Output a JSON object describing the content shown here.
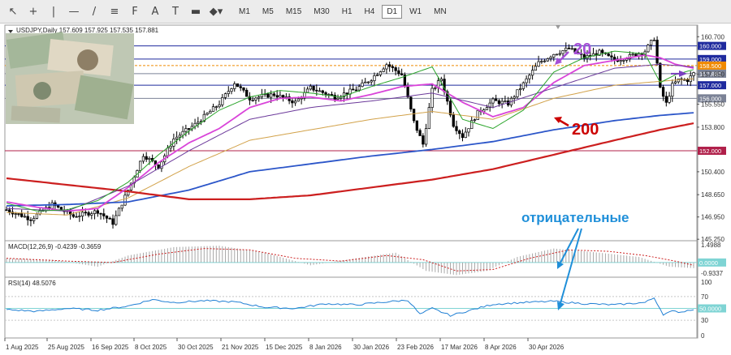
{
  "toolbar": {
    "tools": [
      {
        "name": "cursor-icon",
        "glyph": "↖"
      },
      {
        "name": "crosshair-icon",
        "glyph": "+"
      },
      {
        "name": "vertical-line-icon",
        "glyph": "|"
      },
      {
        "name": "horizontal-line-icon",
        "glyph": "—"
      },
      {
        "name": "trendline-icon",
        "glyph": "/"
      },
      {
        "name": "channel-icon",
        "glyph": "≡"
      },
      {
        "name": "fibonacci-icon",
        "glyph": "F"
      },
      {
        "name": "text-icon",
        "glyph": "A"
      },
      {
        "name": "text-label-icon",
        "glyph": "T"
      },
      {
        "name": "rectangle-icon",
        "glyph": "▬"
      },
      {
        "name": "shapes-dropdown-icon",
        "glyph": "◆▾"
      }
    ],
    "timeframes": [
      "M1",
      "M5",
      "M15",
      "M30",
      "H1",
      "H4",
      "D1",
      "W1",
      "MN"
    ],
    "active_timeframe": "D1"
  },
  "chart_data": {
    "type": "candlestick",
    "header": "USDJPY,Daily  157.609 157.925 157.535 157.881",
    "x_ticks": [
      "1 Aug 2025",
      "25 Aug 2025",
      "16 Sep 2025",
      "8 Oct 2025",
      "30 Oct 2025",
      "21 Nov 2025",
      "15 Dec 2025",
      "8 Jan 2026",
      "30 Jan 2026",
      "23 Feb 2026",
      "17 Mar 2026",
      "8 Apr 2026",
      "30 Apr 2026"
    ],
    "ylim": [
      145.2,
      161.4
    ],
    "y_ticks": [
      160.7,
      157.85,
      155.55,
      153.8,
      150.4,
      148.65,
      146.95,
      145.25
    ],
    "price_levels": [
      {
        "value": 160.0,
        "label": "160.000",
        "color": "#1f2a9e"
      },
      {
        "value": 159.0,
        "label": "159.000",
        "color": "#1f2a9e"
      },
      {
        "value": 158.5,
        "label": "158.500",
        "color": "#f08a00"
      },
      {
        "value": 157.881,
        "label": "157.881",
        "color": "#7b8296"
      },
      {
        "value": 157.0,
        "label": "157.000",
        "color": "#1f2a9e"
      },
      {
        "value": 156.0,
        "label": "156.000",
        "color": "#7b8296"
      },
      {
        "value": 152.0,
        "label": "152.000",
        "color": "#b0204a"
      }
    ],
    "bid_price": 157.881,
    "ma_labels": [
      {
        "text": "20",
        "color": "#a64fd6"
      },
      {
        "text": "200",
        "color": "#cc0000"
      }
    ],
    "annotation": {
      "text": "отрицательные",
      "color": "#1f8fd9"
    },
    "ma_anchors": {
      "ma20": [
        [
          0,
          148.1
        ],
        [
          10,
          147.7
        ],
        [
          20,
          147.4
        ],
        [
          30,
          147.6
        ],
        [
          40,
          149.2
        ],
        [
          50,
          151.1
        ],
        [
          60,
          152.6
        ],
        [
          70,
          153.7
        ],
        [
          80,
          155.3
        ],
        [
          90,
          156.0
        ],
        [
          100,
          156.1
        ],
        [
          110,
          155.8
        ],
        [
          120,
          156.3
        ],
        [
          130,
          156.9
        ],
        [
          140,
          157.1
        ],
        [
          150,
          155.7
        ],
        [
          160,
          154.6
        ],
        [
          170,
          155.3
        ],
        [
          180,
          157.2
        ],
        [
          190,
          158.5
        ],
        [
          200,
          158.9
        ],
        [
          210,
          159.3
        ],
        [
          215,
          159.1
        ],
        [
          220,
          158.6
        ],
        [
          226,
          158.3
        ]
      ],
      "ma200": [
        [
          0,
          149.9
        ],
        [
          20,
          149.4
        ],
        [
          40,
          148.9
        ],
        [
          60,
          148.3
        ],
        [
          80,
          148.3
        ],
        [
          100,
          148.6
        ],
        [
          120,
          149.2
        ],
        [
          140,
          149.8
        ],
        [
          160,
          150.6
        ],
        [
          180,
          151.7
        ],
        [
          200,
          152.8
        ],
        [
          215,
          153.6
        ],
        [
          226,
          154.1
        ]
      ],
      "ma100": [
        [
          0,
          147.8
        ],
        [
          20,
          147.9
        ],
        [
          40,
          148.1
        ],
        [
          60,
          149.0
        ],
        [
          80,
          150.4
        ],
        [
          100,
          151.0
        ],
        [
          120,
          151.6
        ],
        [
          140,
          152.1
        ],
        [
          160,
          152.7
        ],
        [
          180,
          153.6
        ],
        [
          200,
          154.3
        ],
        [
          215,
          154.7
        ],
        [
          226,
          154.9
        ]
      ],
      "ma50": [
        [
          0,
          147.3
        ],
        [
          20,
          147.1
        ],
        [
          40,
          148.4
        ],
        [
          60,
          150.8
        ],
        [
          80,
          152.8
        ],
        [
          100,
          153.6
        ],
        [
          120,
          154.4
        ],
        [
          140,
          155.0
        ],
        [
          160,
          154.4
        ],
        [
          180,
          156.0
        ],
        [
          200,
          157.0
        ],
        [
          215,
          157.3
        ],
        [
          226,
          157.5
        ]
      ],
      "ma30": [
        [
          0,
          147.6
        ],
        [
          20,
          147.4
        ],
        [
          40,
          149.3
        ],
        [
          60,
          152.0
        ],
        [
          80,
          154.4
        ],
        [
          100,
          155.3
        ],
        [
          120,
          155.8
        ],
        [
          140,
          156.4
        ],
        [
          160,
          155.3
        ],
        [
          180,
          156.8
        ],
        [
          200,
          158.3
        ],
        [
          215,
          158.6
        ],
        [
          226,
          158.4
        ]
      ],
      "ma10": [
        [
          0,
          148.0
        ],
        [
          10,
          147.4
        ],
        [
          20,
          147.5
        ],
        [
          30,
          148.2
        ],
        [
          40,
          149.6
        ],
        [
          50,
          151.7
        ],
        [
          60,
          153.5
        ],
        [
          70,
          155.1
        ],
        [
          80,
          156.1
        ],
        [
          90,
          156.6
        ],
        [
          100,
          156.4
        ],
        [
          110,
          156.1
        ],
        [
          120,
          156.9
        ],
        [
          130,
          157.6
        ],
        [
          140,
          158.4
        ],
        [
          150,
          154.4
        ],
        [
          160,
          153.7
        ],
        [
          170,
          155.1
        ],
        [
          180,
          158.0
        ],
        [
          190,
          159.1
        ],
        [
          200,
          159.6
        ],
        [
          210,
          159.4
        ],
        [
          215,
          157.2
        ],
        [
          220,
          157.8
        ],
        [
          226,
          158.2
        ]
      ],
      "close": [
        [
          0,
          147.5
        ],
        [
          8,
          146.8
        ],
        [
          15,
          147.9
        ],
        [
          22,
          147.0
        ],
        [
          30,
          147.4
        ],
        [
          35,
          146.5
        ],
        [
          40,
          149.0
        ],
        [
          45,
          151.7
        ],
        [
          50,
          150.8
        ],
        [
          55,
          152.9
        ],
        [
          62,
          154.0
        ],
        [
          70,
          155.6
        ],
        [
          75,
          157.2
        ],
        [
          80,
          156.0
        ],
        [
          88,
          156.3
        ],
        [
          95,
          155.7
        ],
        [
          100,
          156.8
        ],
        [
          108,
          156.1
        ],
        [
          115,
          156.7
        ],
        [
          120,
          157.5
        ],
        [
          125,
          158.6
        ],
        [
          130,
          157.8
        ],
        [
          134,
          154.2
        ],
        [
          137,
          152.5
        ],
        [
          140,
          156.6
        ],
        [
          143,
          157.5
        ],
        [
          147,
          154.0
        ],
        [
          150,
          153.1
        ],
        [
          155,
          154.9
        ],
        [
          160,
          155.8
        ],
        [
          165,
          155.6
        ],
        [
          170,
          157.1
        ],
        [
          175,
          158.7
        ],
        [
          180,
          159.4
        ],
        [
          185,
          159.8
        ],
        [
          190,
          159.1
        ],
        [
          195,
          159.5
        ],
        [
          200,
          158.9
        ],
        [
          205,
          159.2
        ],
        [
          210,
          159.6
        ],
        [
          213,
          160.6
        ],
        [
          215,
          156.7
        ],
        [
          217,
          155.6
        ],
        [
          219,
          157.0
        ],
        [
          221,
          157.4
        ],
        [
          224,
          157.4
        ],
        [
          226,
          157.9
        ]
      ],
      "macd_hist": [
        [
          0,
          0.3
        ],
        [
          15,
          0.2
        ],
        [
          30,
          -0.3
        ],
        [
          40,
          0.5
        ],
        [
          55,
          1.1
        ],
        [
          70,
          1.2
        ],
        [
          85,
          0.7
        ],
        [
          100,
          -0.2
        ],
        [
          115,
          0.3
        ],
        [
          128,
          0.7
        ],
        [
          138,
          -0.6
        ],
        [
          148,
          -0.9
        ],
        [
          158,
          -0.6
        ],
        [
          168,
          0.4
        ],
        [
          180,
          1.0
        ],
        [
          195,
          0.7
        ],
        [
          208,
          0.4
        ],
        [
          218,
          -0.3
        ],
        [
          226,
          -0.4
        ]
      ],
      "macd_signal": [
        [
          0,
          0.3
        ],
        [
          20,
          0.1
        ],
        [
          35,
          0.0
        ],
        [
          50,
          0.6
        ],
        [
          65,
          1.0
        ],
        [
          80,
          0.9
        ],
        [
          95,
          0.3
        ],
        [
          110,
          0.1
        ],
        [
          125,
          0.5
        ],
        [
          137,
          0.2
        ],
        [
          148,
          -0.6
        ],
        [
          160,
          -0.5
        ],
        [
          172,
          0.3
        ],
        [
          185,
          0.9
        ],
        [
          198,
          0.8
        ],
        [
          210,
          0.5
        ],
        [
          220,
          0.1
        ],
        [
          226,
          -0.2
        ]
      ],
      "rsi": [
        [
          0,
          48
        ],
        [
          10,
          45
        ],
        [
          20,
          50
        ],
        [
          30,
          47
        ],
        [
          40,
          54
        ],
        [
          48,
          65
        ],
        [
          55,
          60
        ],
        [
          65,
          63
        ],
        [
          75,
          61
        ],
        [
          85,
          52
        ],
        [
          95,
          50
        ],
        [
          105,
          58
        ],
        [
          115,
          56
        ],
        [
          125,
          61
        ],
        [
          132,
          64
        ],
        [
          136,
          40
        ],
        [
          140,
          50
        ],
        [
          146,
          38
        ],
        [
          152,
          46
        ],
        [
          160,
          57
        ],
        [
          170,
          60
        ],
        [
          180,
          62
        ],
        [
          190,
          58
        ],
        [
          200,
          56
        ],
        [
          210,
          60
        ],
        [
          213,
          68
        ],
        [
          216,
          40
        ],
        [
          219,
          45
        ],
        [
          222,
          44
        ],
        [
          226,
          49
        ]
      ]
    },
    "macd": {
      "label": "MACD(12,26,9) -0.4239 -0.3659",
      "ylim": [
        -0.9337,
        1.4988
      ],
      "y_ticks": [
        "1.4988",
        "0.0000",
        "-0.9337"
      ]
    },
    "rsi_panel": {
      "label": "RSI(14) 48.5076",
      "ylim": [
        0,
        100
      ],
      "y_ticks": [
        "100",
        "70",
        "50.0000",
        "30",
        "0"
      ]
    }
  }
}
